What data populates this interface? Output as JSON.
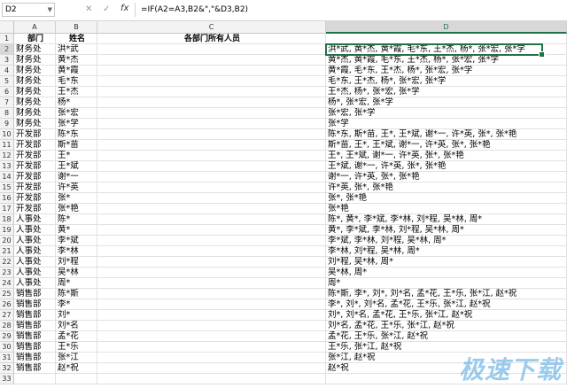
{
  "formula_bar": {
    "cell_ref": "D2",
    "cancel_icon": "✕",
    "enter_icon": "✓",
    "fx_label": "fx",
    "formula": "=IF(A2=A3,B2&\",\"&D3,B2)"
  },
  "columns": [
    "A",
    "B",
    "C",
    "D"
  ],
  "headers": {
    "dept": "部门",
    "name": "姓名",
    "c": "各部门所有人员"
  },
  "rows": [
    {
      "dept": "财务处",
      "name": "洪*武",
      "d": "洪*武, 黄*杰, 黄*霞, 毛*东, 王*杰, 杨*, 张*宏, 张*学"
    },
    {
      "dept": "财务处",
      "name": "黄*杰",
      "d": "黄*杰, 黄*霞, 毛*东, 王*杰, 杨*, 张*宏, 张*学"
    },
    {
      "dept": "财务处",
      "name": "黄*霞",
      "d": "黄*霞, 毛*东, 王*杰, 杨*, 张*宏, 张*学"
    },
    {
      "dept": "财务处",
      "name": "毛*东",
      "d": "毛*东, 王*杰, 杨*, 张*宏, 张*学"
    },
    {
      "dept": "财务处",
      "name": "王*杰",
      "d": "王*杰, 杨*, 张*宏, 张*学"
    },
    {
      "dept": "财务处",
      "name": "杨*",
      "d": "杨*, 张*宏, 张*学"
    },
    {
      "dept": "财务处",
      "name": "张*宏",
      "d": "张*宏, 张*学"
    },
    {
      "dept": "财务处",
      "name": "张*学",
      "d": "张*学"
    },
    {
      "dept": "开发部",
      "name": "陈*东",
      "d": "陈*东, 斯*苗, 王*, 王*斌, 谢*一, 许*英, 张*, 张*艳"
    },
    {
      "dept": "开发部",
      "name": "斯*苗",
      "d": "斯*苗, 王*, 王*斌, 谢*一, 许*英, 张*, 张*艳"
    },
    {
      "dept": "开发部",
      "name": "王*",
      "d": "王*, 王*斌, 谢*一, 许*英, 张*, 张*艳"
    },
    {
      "dept": "开发部",
      "name": "王*斌",
      "d": "王*斌, 谢*一, 许*英, 张*, 张*艳"
    },
    {
      "dept": "开发部",
      "name": "谢*一",
      "d": "谢*一, 许*英, 张*, 张*艳"
    },
    {
      "dept": "开发部",
      "name": "许*英",
      "d": "许*英, 张*, 张*艳"
    },
    {
      "dept": "开发部",
      "name": "张*",
      "d": "张*, 张*艳"
    },
    {
      "dept": "开发部",
      "name": "张*艳",
      "d": "张*艳"
    },
    {
      "dept": "人事处",
      "name": "陈*",
      "d": "陈*, 黄*, 李*斌, 李*林, 刘*程, 吴*林, 周*"
    },
    {
      "dept": "人事处",
      "name": "黄*",
      "d": "黄*, 李*斌, 李*林, 刘*程, 吴*林, 周*"
    },
    {
      "dept": "人事处",
      "name": "李*斌",
      "d": "李*斌, 李*林, 刘*程, 吴*林, 周*"
    },
    {
      "dept": "人事处",
      "name": "李*林",
      "d": "李*林, 刘*程, 吴*林, 周*"
    },
    {
      "dept": "人事处",
      "name": "刘*程",
      "d": "刘*程, 吴*林, 周*"
    },
    {
      "dept": "人事处",
      "name": "吴*林",
      "d": "吴*林, 周*"
    },
    {
      "dept": "人事处",
      "name": "周*",
      "d": "周*"
    },
    {
      "dept": "销售部",
      "name": "陈*斯",
      "d": "陈*斯, 李*, 刘*, 刘*名, 孟*花, 王*乐, 张*江, 赵*祝"
    },
    {
      "dept": "销售部",
      "name": "李*",
      "d": "李*, 刘*, 刘*名, 孟*花, 王*乐, 张*江, 赵*祝"
    },
    {
      "dept": "销售部",
      "name": "刘*",
      "d": "刘*, 刘*名, 孟*花, 王*乐, 张*江, 赵*祝"
    },
    {
      "dept": "销售部",
      "name": "刘*名",
      "d": "刘*名, 孟*花, 王*乐, 张*江, 赵*祝"
    },
    {
      "dept": "销售部",
      "name": "孟*花",
      "d": "孟*花, 王*乐, 张*江, 赵*祝"
    },
    {
      "dept": "销售部",
      "name": "王*乐",
      "d": "王*乐, 张*江, 赵*祝"
    },
    {
      "dept": "销售部",
      "name": "张*江",
      "d": "张*江, 赵*祝"
    },
    {
      "dept": "销售部",
      "name": "赵*祝",
      "d": "赵*祝"
    }
  ],
  "extra_rows": [
    "33"
  ],
  "watermark": "极速下载"
}
